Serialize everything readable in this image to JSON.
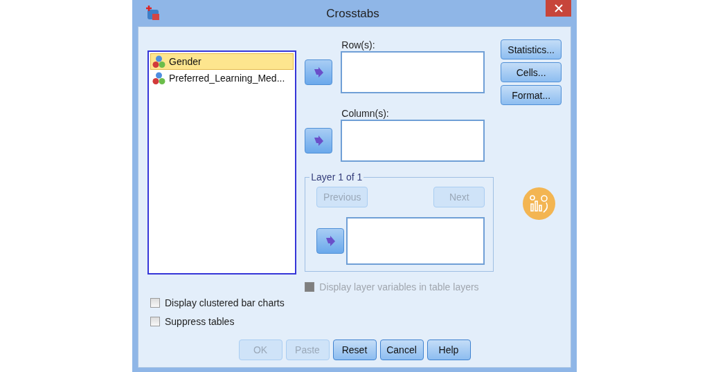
{
  "window": {
    "title": "Crosstabs"
  },
  "variables": [
    {
      "label": "Gender",
      "selected": true
    },
    {
      "label": "Preferred_Learning_Med...",
      "selected": false
    }
  ],
  "targets": [
    {
      "label": "Row(s):"
    },
    {
      "label": "Column(s):"
    }
  ],
  "side_buttons": [
    {
      "label": "Statistics..."
    },
    {
      "label": "Cells..."
    },
    {
      "label": "Format..."
    }
  ],
  "layer": {
    "legend": "Layer 1 of 1",
    "previous": {
      "label": "Previous",
      "disabled": true
    },
    "next": {
      "label": "Next",
      "disabled": true
    }
  },
  "layer_option": {
    "label": "Display layer variables in table layers",
    "checked": false,
    "disabled": true
  },
  "options": [
    {
      "label": "Display clustered bar charts",
      "checked": false
    },
    {
      "label": "Suppress tables",
      "checked": false
    }
  ],
  "buttons": [
    {
      "label": "OK",
      "disabled": true
    },
    {
      "label": "Paste",
      "disabled": true
    },
    {
      "label": "Reset",
      "disabled": false
    },
    {
      "label": "Cancel",
      "disabled": false
    },
    {
      "label": "Help",
      "disabled": false
    }
  ]
}
